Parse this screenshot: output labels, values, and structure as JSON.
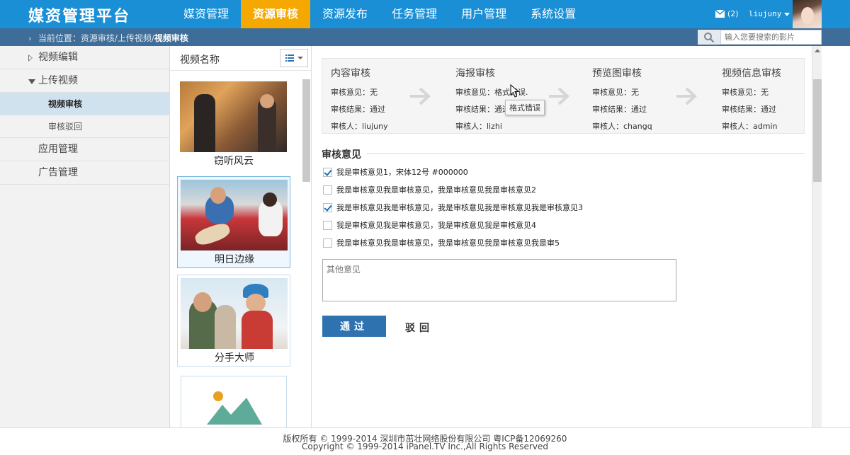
{
  "app": {
    "logo": "媒资管理平台"
  },
  "nav": {
    "items": [
      {
        "label": "媒资管理",
        "active": false
      },
      {
        "label": "资源审核",
        "active": true
      },
      {
        "label": "资源发布",
        "active": false
      },
      {
        "label": "任务管理",
        "active": false
      },
      {
        "label": "用户管理",
        "active": false
      },
      {
        "label": "系统设置",
        "active": false
      }
    ]
  },
  "header": {
    "mail_count": "(2)",
    "username": "liujuny"
  },
  "breadcrumb": {
    "prefix": "当前位置：资源审核/上传视频/",
    "current": "视频审核"
  },
  "search": {
    "placeholder": "输入您要搜索的影片"
  },
  "sidebar": {
    "items": [
      {
        "label": "视频编辑"
      },
      {
        "label": "上传视频"
      },
      {
        "label": "视频审核"
      },
      {
        "label": "审核驳回"
      },
      {
        "label": "应用管理"
      },
      {
        "label": "广告管理"
      }
    ]
  },
  "video_list": {
    "title": "视频名称",
    "items": [
      {
        "title": "窃听风云"
      },
      {
        "title": "明日边缘"
      },
      {
        "title": "分手大师"
      }
    ]
  },
  "flow": {
    "steps": [
      {
        "title": "内容审核",
        "opinion": "审核意见：无",
        "result": "审核结果：通过",
        "reviewer": "审核人：liujuny"
      },
      {
        "title": "海报审核",
        "opinion": "审核意见：格式错误.",
        "result": "审核结果：通过",
        "reviewer": "审核人：lizhi"
      },
      {
        "title": "预览图审核",
        "opinion": "审核意见：无",
        "result": "审核结果：通过",
        "reviewer": "审核人：changq"
      },
      {
        "title": "视频信息审核",
        "opinion": "审核意见：无",
        "result": "审核结果：通过",
        "reviewer": "审核人：admin"
      }
    ],
    "tooltip": "格式错误"
  },
  "review": {
    "title": "审核意见",
    "options": [
      {
        "label": "我是审核意见1，宋体12号 #000000",
        "checked": true
      },
      {
        "label": "我是审核意见我是审核意见，我是审核意见我是审核意见2",
        "checked": false
      },
      {
        "label": "我是审核意见我是审核意见，我是审核意见我是审核意见我是审核意见3",
        "checked": true
      },
      {
        "label": "我是审核意见我是审核意见，我是审核意见我是审核意见4",
        "checked": false
      },
      {
        "label": "我是审核意见我是审核意见，我是审核意见我是审核意见我是审5",
        "checked": false
      }
    ],
    "other_placeholder": "其他意见",
    "pass_label": "通过",
    "reject_label": "驳回"
  },
  "footer": {
    "line1": "版权所有 © 1999-2014 深圳市茁壮网络股份有限公司    粤ICP备12069260",
    "line2": "Copyright © 1999-2014 iPanel.TV Inc.,All Rights Reserved"
  },
  "colors": {
    "header": "#1a8fd6",
    "active_nav": "#f5a800",
    "crumb_bar": "#3d6d98",
    "primary_button": "#2f72b0"
  }
}
